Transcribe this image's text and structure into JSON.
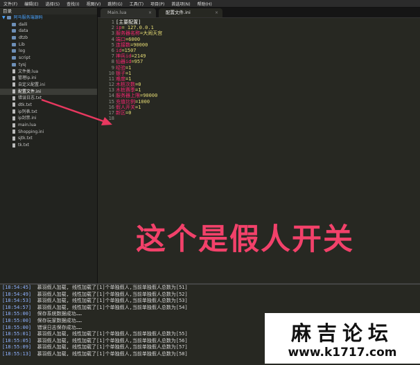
{
  "menu": [
    "文件(F)",
    "编辑(E)",
    "选择(S)",
    "查找(I)",
    "视图(V)",
    "跳转(G)",
    "工具(T)",
    "项目(P)",
    "首选项(N)",
    "帮助(H)"
  ],
  "sidebar": {
    "title": "目录",
    "root": "阿马服务端源码",
    "folders": [
      "daili",
      "data",
      "dtzb",
      "Lib",
      "log",
      "script",
      "tysj"
    ],
    "files": [
      "文件类.lua",
      "管理ip.ini",
      "自定义配置.ini",
      "配置文件.ini",
      "错误日志.txt",
      "dtk.txt",
      "ip列表.txt",
      "ip封禁.ini",
      "main.lua",
      "Shopping.ini",
      "sjtk.txt",
      "tk.txt"
    ],
    "selected": "配置文件.ini"
  },
  "tabs": [
    {
      "label": "Main.lua",
      "close": "×"
    },
    {
      "label": "配置文件.ini",
      "close": "×"
    }
  ],
  "editor": {
    "line_numbers": [
      "1",
      "2",
      "3",
      "4",
      "5",
      "6",
      "7",
      "8",
      "9",
      "10",
      "11",
      "12",
      "13",
      "14",
      "15",
      "16",
      "17",
      "18"
    ],
    "section": "[主要配置]",
    "lines": [
      {
        "key": "ip",
        "value": "= 127.0.0.1"
      },
      {
        "key": "服务器名称",
        "value": "=大闹天宫"
      },
      {
        "key": "端口",
        "value": "=6000"
      },
      {
        "key": "连接数",
        "value": "=90000"
      },
      {
        "key": "id",
        "value": "=1507"
      },
      {
        "key": "神兵id",
        "value": "=2149"
      },
      {
        "key": "仙器id",
        "value": "=957"
      },
      {
        "key": "经验",
        "value": "=1"
      },
      {
        "key": "银子",
        "value": "=1"
      },
      {
        "key": "难度",
        "value": "=1"
      },
      {
        "key": "木桩次数",
        "value": "=0"
      },
      {
        "key": "木桩赛季",
        "value": "=1"
      },
      {
        "key": "服务器上限",
        "value": "=90000"
      },
      {
        "key": "充值比例",
        "value": "=1000"
      },
      {
        "key": "假人开关",
        "value": "=1"
      },
      {
        "key": "新区",
        "value": "=0"
      }
    ]
  },
  "annotation": "这个是假人开关",
  "console": [
    {
      "time": "[18:54:45]",
      "text": "慕羽假人加载, 线性加载了[1]个单独假人,当前单独假人总数为[51]"
    },
    {
      "time": "[18:54:49]",
      "text": "慕羽假人加载, 线性加载了[1]个单独假人,当前单独假人总数为[52]"
    },
    {
      "time": "[18:54:53]",
      "text": "慕羽假人加载, 线性加载了[1]个单独假人,当前单独假人总数为[53]"
    },
    {
      "time": "[18:54:57]",
      "text": "慕羽假人加载, 线性加载了[1]个单独假人,当前单独假人总数为[54]"
    },
    {
      "time": "[18:55:00]",
      "text": "保存系统数据成功……"
    },
    {
      "time": "[18:55:00]",
      "text": "保存玩家数据成功……"
    },
    {
      "time": "[18:55:00]",
      "text": "错误日志保存成功……"
    },
    {
      "time": "[18:55:01]",
      "text": "慕羽假人加载, 线性加载了[1]个单独假人,当前单独假人总数为[55]"
    },
    {
      "time": "[18:55:05]",
      "text": "慕羽假人加载, 线性加载了[1]个单独假人,当前单独假人总数为[56]"
    },
    {
      "time": "[18:55:09]",
      "text": "慕羽假人加载, 线性加载了[1]个单独假人,当前单独假人总数为[57]"
    },
    {
      "time": "[18:55:13]",
      "text": "慕羽假人加载, 线性加载了[1]个单独假人,当前单独假人总数为[58]"
    }
  ],
  "watermark": {
    "title": "麻吉论坛",
    "url": "www.k1717.com"
  }
}
